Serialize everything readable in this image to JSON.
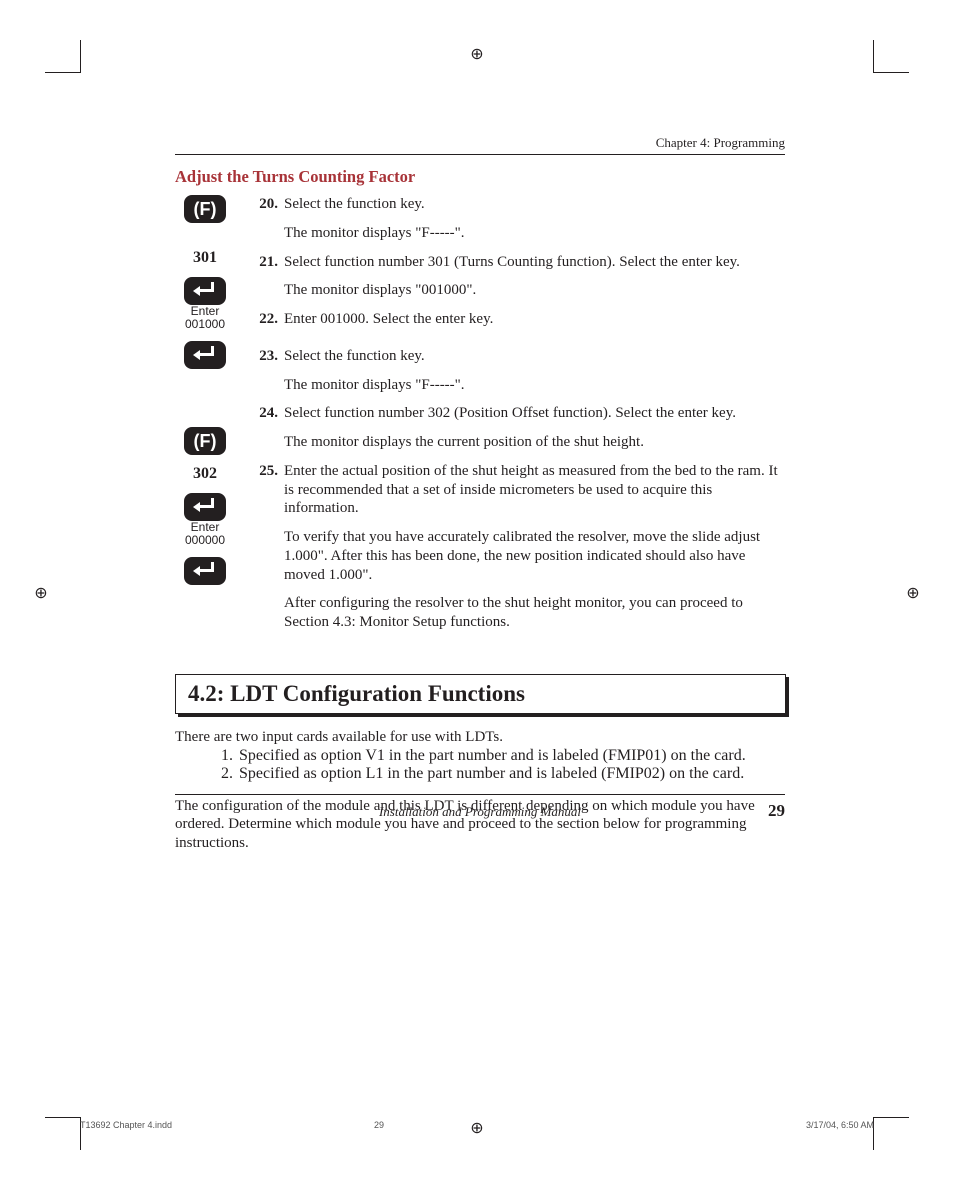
{
  "chapter_header": "Chapter 4:  Programming",
  "subheading": "Adjust the Turns Counting Factor",
  "sidebar_group1": {
    "key_f": "(F)",
    "num301": "301",
    "enter_label": "Enter",
    "value001000": "001000"
  },
  "sidebar_group2": {
    "key_f": "(F)",
    "num302": "302",
    "enter_label": "Enter",
    "value000000": "000000"
  },
  "steps": {
    "s20": {
      "n": "20",
      "t": "Select the function key."
    },
    "note_a": "The monitor displays \"F-----\".",
    "s21": {
      "n": "21",
      "t": "Select function number 301 (Turns Counting function). Select the enter key."
    },
    "note_b": "The monitor displays \"001000\".",
    "s22": {
      "n": "22",
      "t": "Enter 001000. Select the enter key."
    },
    "s23": {
      "n": "23",
      "t": "Select the function key."
    },
    "note_c": "The monitor displays \"F-----\".",
    "s24": {
      "n": "24",
      "t": "Select function number 302 (Position Offset function). Select the enter key."
    },
    "note_d": "The monitor displays the current position of the shut height.",
    "s25": {
      "n": "25",
      "t": "Enter the actual position of the shut height as measured from the bed to the ram. It is recommended that a set of inside micrometers be used to acquire this information."
    },
    "note_e": "To verify that you have accurately calibrated the resolver, move the slide adjust 1.000\". After this has been done, the new position indicated should also have moved 1.000\".",
    "note_f": "After configuring the resolver to the shut height monitor, you can proceed to Section 4.3: Monitor Setup functions."
  },
  "section_heading": "4.2:  LDT Configuration Functions",
  "intro_para": "There are two input cards available for use with LDTs.",
  "enum1": {
    "n": "1",
    "t": "Specified as option V1 in the part number and is labeled (FMIP01) on the card."
  },
  "enum2": {
    "n": "2",
    "t": "Specified as option L1 in the part number and is labeled (FMIP02) on the card."
  },
  "config_para": "The configuration of the module and this LDT is different depending on which module you have ordered.  Determine which module you have and proceed to the section below for programming instructions.",
  "footer_title": "Installation and Programming Manual",
  "footer_page": "29",
  "imposition": {
    "file": "T13692 Chapter 4.indd",
    "page": "29",
    "datetime": "3/17/04, 6:50 AM"
  }
}
